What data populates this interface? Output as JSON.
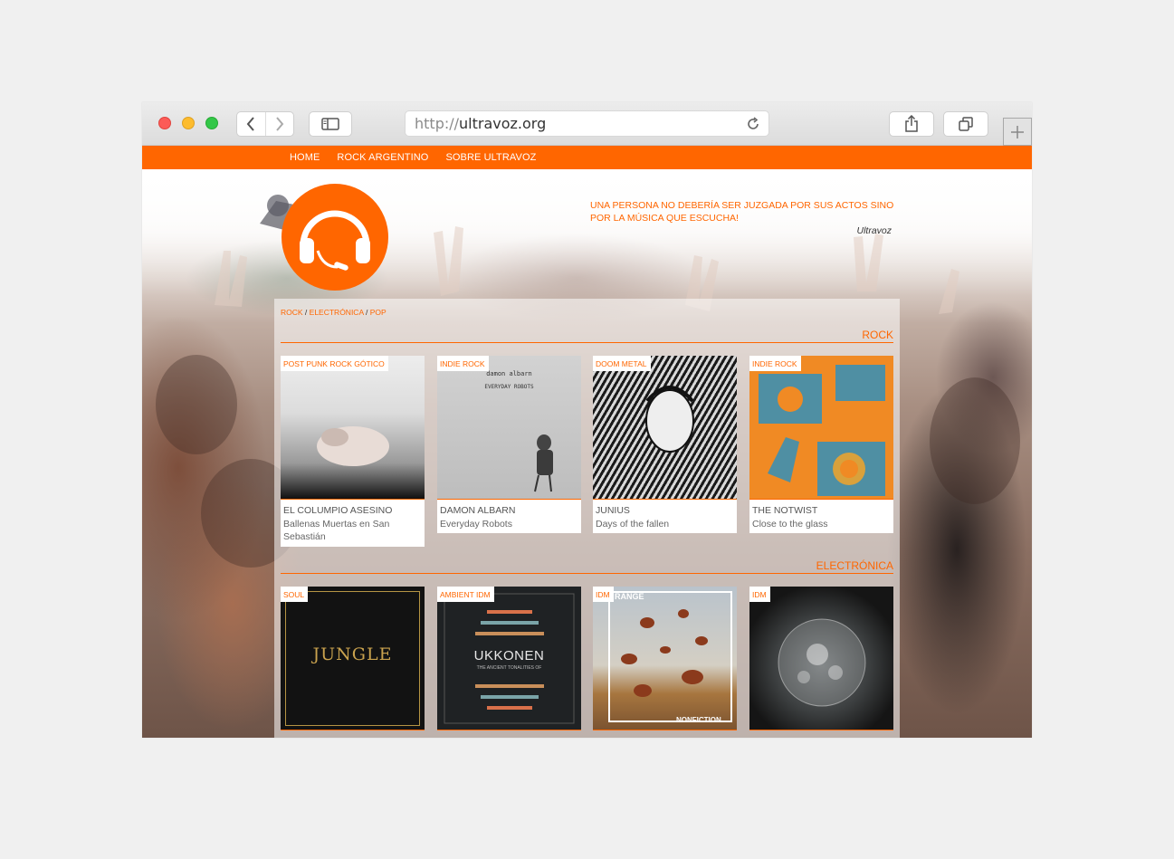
{
  "browser": {
    "url_scheme": "http://",
    "url_host": "ultravoz.org",
    "icons": [
      "back-icon",
      "forward-icon",
      "sidebar-icon",
      "reload-icon",
      "share-icon",
      "tabs-icon",
      "new-tab-icon"
    ]
  },
  "nav": {
    "items": [
      "HOME",
      "ROCK ARGENTINO",
      "SOBRE ULTRAVOZ"
    ]
  },
  "header": {
    "quote": "UNA PERSONA NO DEBERÍA SER JUZGADA POR SUS ACTOS SINO POR LA MÚSICA QUE ESCUCHA!",
    "quote_author": "Ultravoz",
    "logo_icon": "headphones-icon"
  },
  "breadcrumb": {
    "items": [
      "ROCK",
      "ELECTRÓNICA",
      "POP"
    ],
    "separator": " / "
  },
  "sections": [
    {
      "title": "ROCK",
      "cards": [
        {
          "tag": "POST PUNK ROCK GÓTICO",
          "artist": "EL COLUMPIO ASESINO",
          "album": "Ballenas Muertas en San Sebastián"
        },
        {
          "tag": "INDIE ROCK",
          "artist": "DAMON ALBARN",
          "album": "Everyday Robots",
          "art_text_1": "damon albarn",
          "art_text_2": "EVERYDAY ROBOTS"
        },
        {
          "tag": "DOOM METAL",
          "artist": "JUNIUS",
          "album": "Days of the fallen"
        },
        {
          "tag": "INDIE ROCK",
          "artist": "THE NOTWIST",
          "album": "Close to the glass"
        }
      ]
    },
    {
      "title": "ELECTRÓNICA",
      "cards": [
        {
          "tag": "SOUL",
          "artist": "",
          "album": "",
          "art_text_1": "JUNGLE"
        },
        {
          "tag": "AMBIENT IDM",
          "artist": "",
          "album": "",
          "art_text_1": "UKKONEN",
          "art_text_2": "THE ANCIENT TONALITIES OF"
        },
        {
          "tag": "IDM",
          "artist": "",
          "album": "",
          "art_text_1": "RANGE",
          "art_text_2": "NONFICTION"
        },
        {
          "tag": "IDM",
          "artist": "",
          "album": ""
        }
      ]
    }
  ],
  "colors": {
    "brand": "#ff6600",
    "background": "#f0f0f0"
  }
}
